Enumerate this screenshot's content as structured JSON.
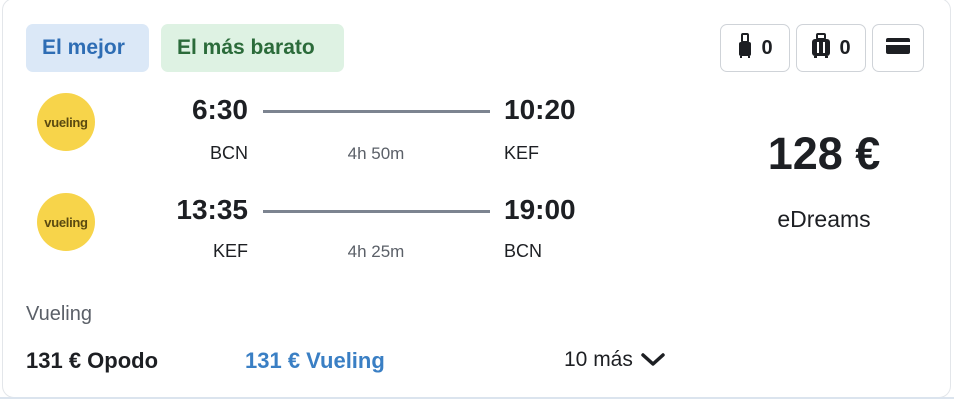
{
  "badges": {
    "best": "El mejor",
    "cheapest": "El más barato"
  },
  "bag_filters": {
    "carry_on": {
      "icon": "carry-on-bag-icon",
      "count": "0"
    },
    "checked": {
      "icon": "checked-bag-icon",
      "count": "0"
    },
    "payment": {
      "icon": "credit-card-icon"
    }
  },
  "legs": [
    {
      "airline_logo_text": "vueling",
      "dep_time": "6:30",
      "arr_time": "10:20",
      "dep_airport": "BCN",
      "arr_airport": "KEF",
      "duration": "4h 50m"
    },
    {
      "airline_logo_text": "vueling",
      "dep_time": "13:35",
      "arr_time": "19:00",
      "dep_airport": "KEF",
      "arr_airport": "BCN",
      "duration": "4h 25m"
    }
  ],
  "offer": {
    "price": "128 €",
    "provider": "eDreams"
  },
  "footer": {
    "airline": "Vueling",
    "deals": [
      "131 € Opodo",
      "131 € Vueling"
    ],
    "more": "10 más"
  },
  "colors": {
    "best_badge_bg": "#dbe8f7",
    "cheap_badge_bg": "#def2e3",
    "link": "#3a7fc4",
    "logo": "#f7d44a"
  }
}
